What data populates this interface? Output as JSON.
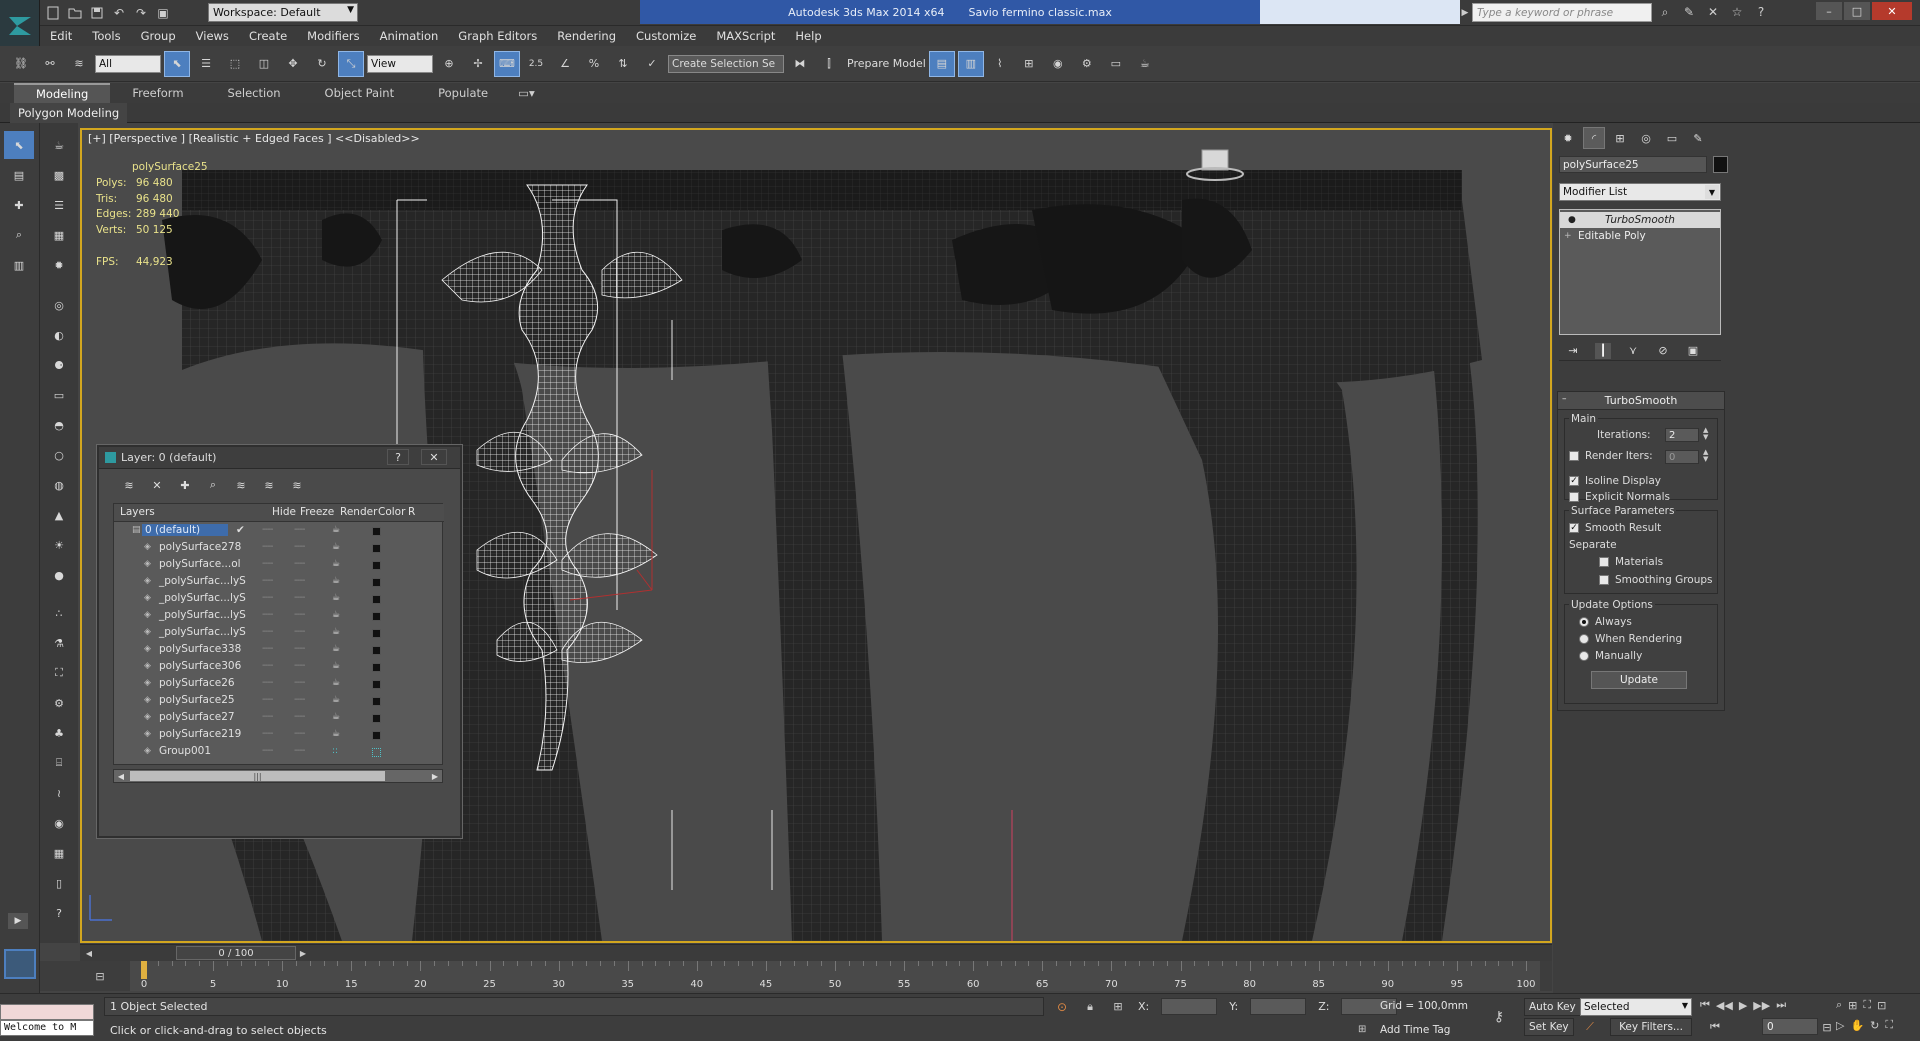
{
  "titlebar": {
    "workspace": "Workspace: Default",
    "app_title": "Autodesk 3ds Max  2014 x64",
    "file_name": "Savio fermino classic.max",
    "search_placeholder": "Type a keyword or phrase"
  },
  "menu": [
    "Edit",
    "Tools",
    "Group",
    "Views",
    "Create",
    "Modifiers",
    "Animation",
    "Graph Editors",
    "Rendering",
    "Customize",
    "MAXScript",
    "Help"
  ],
  "toolbar": {
    "filter": "All",
    "ref_coord": "View",
    "selection_set": "Create Selection Se",
    "prepare_model": "Prepare Model",
    "snap_value": "2.5"
  },
  "ribbon": {
    "tabs": [
      "Modeling",
      "Freeform",
      "Selection",
      "Object Paint",
      "Populate"
    ],
    "active": "Modeling",
    "panel": "Polygon Modeling"
  },
  "viewport": {
    "label": "[+] [Perspective ] [Realistic + Edged Faces ]  <<Disabled>>",
    "object": "polySurface25",
    "stats": [
      {
        "k": "Polys:",
        "v": "96 480"
      },
      {
        "k": "Tris:",
        "v": "96 480"
      },
      {
        "k": "Edges:",
        "v": "289 440"
      },
      {
        "k": "Verts:",
        "v": "50 125"
      }
    ],
    "fps_label": "FPS:",
    "fps": "44,923"
  },
  "layer_dialog": {
    "title": "Layer: 0 (default)",
    "help": "?",
    "close": "✕",
    "columns": [
      "Layers",
      "Hide",
      "Freeze",
      "Render",
      "Color",
      "R"
    ],
    "rows": [
      {
        "name": "0 (default)",
        "default": true
      },
      {
        "name": "polySurface278"
      },
      {
        "name": "polySurface...ol"
      },
      {
        "name": "_polySurfac...lyS"
      },
      {
        "name": "_polySurfac...lyS"
      },
      {
        "name": "_polySurfac...lyS"
      },
      {
        "name": "_polySurfac...lyS"
      },
      {
        "name": "polySurface338"
      },
      {
        "name": "polySurface306"
      },
      {
        "name": "polySurface26"
      },
      {
        "name": "polySurface25"
      },
      {
        "name": "polySurface27"
      },
      {
        "name": "polySurface219"
      },
      {
        "name": "Group001",
        "group": true
      }
    ],
    "scroll_grip": "|||"
  },
  "command_panel": {
    "object_name": "polySurface25",
    "modifier_list": "Modifier List",
    "stack": [
      "TurboSmooth",
      "Editable Poly"
    ],
    "rollout": {
      "title": "TurboSmooth",
      "main": "Main",
      "iterations_label": "Iterations:",
      "iterations": "2",
      "render_iters_label": "Render Iters:",
      "render_iters": "0",
      "isoline": "Isoline Display",
      "explicit_normals": "Explicit Normals",
      "surface_params": "Surface Parameters",
      "smooth_result": "Smooth Result",
      "separate": "Separate",
      "materials": "Materials",
      "smoothing_groups": "Smoothing Groups",
      "update_options": "Update Options",
      "always": "Always",
      "when_rendering": "When Rendering",
      "manually": "Manually",
      "update_button": "Update"
    }
  },
  "timeline": {
    "slider": "0 / 100",
    "ticks": [
      "0",
      "5",
      "10",
      "15",
      "20",
      "25",
      "30",
      "35",
      "40",
      "45",
      "50",
      "55",
      "60",
      "65",
      "70",
      "75",
      "80",
      "85",
      "90",
      "95",
      "100"
    ]
  },
  "status": {
    "welcome": "Welcome to M",
    "selected": "1 Object Selected",
    "prompt": "Click or click-and-drag to select objects",
    "x_label": "X:",
    "y_label": "Y:",
    "z_label": "Z:",
    "grid": "Grid = 100,0mm",
    "add_time_tag": "Add Time Tag",
    "auto_key": "Auto Key",
    "set_key": "Set Key",
    "selected_drop": "Selected",
    "key_filters": "Key Filters...",
    "frame": "0"
  },
  "colors": {
    "viewport_border": "#d3a71f",
    "selection_blue": "#3e6cab",
    "title_blue": "#3058a6"
  }
}
